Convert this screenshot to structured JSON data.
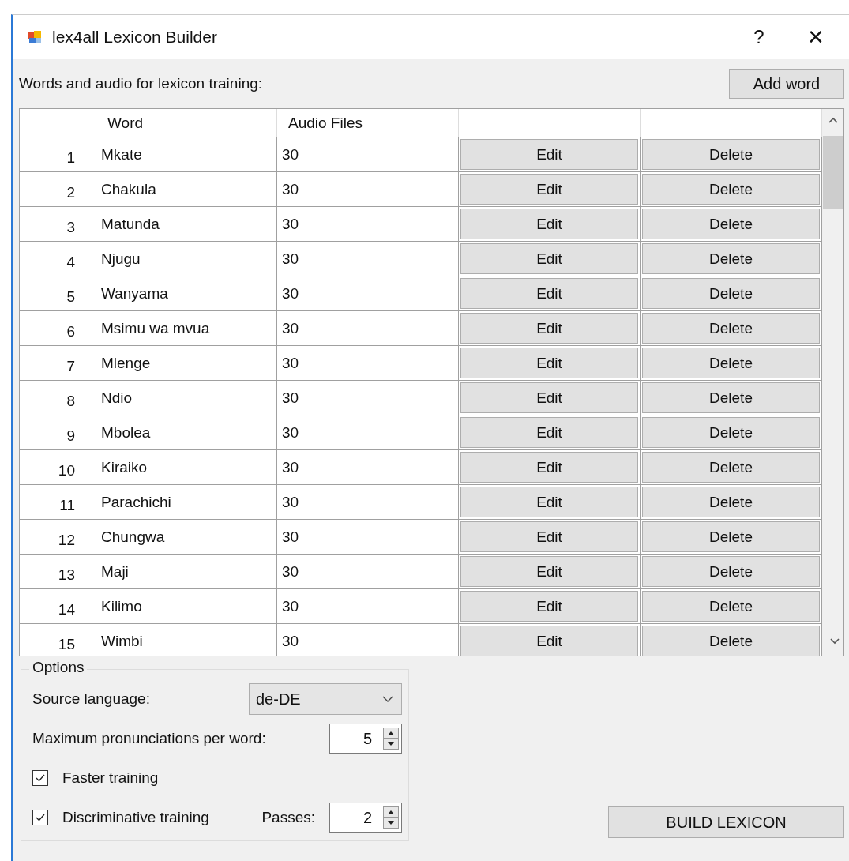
{
  "window": {
    "title": "lex4all Lexicon Builder",
    "help": "?",
    "close": "✕"
  },
  "list_label": "Words and audio for lexicon training:",
  "add_button": "Add word",
  "table": {
    "columns": [
      "Word",
      "Audio Files"
    ],
    "rows": [
      {
        "number": "1",
        "word": "Mkate",
        "audio_files": "30",
        "edit": "Edit",
        "delete": "Delete"
      },
      {
        "number": "2",
        "word": "Chakula",
        "audio_files": "30",
        "edit": "Edit",
        "delete": "Delete"
      },
      {
        "number": "3",
        "word": "Matunda",
        "audio_files": "30",
        "edit": "Edit",
        "delete": "Delete"
      },
      {
        "number": "4",
        "word": "Njugu",
        "audio_files": "30",
        "edit": "Edit",
        "delete": "Delete"
      },
      {
        "number": "5",
        "word": "Wanyama",
        "audio_files": "30",
        "edit": "Edit",
        "delete": "Delete"
      },
      {
        "number": "6",
        "word": "Msimu wa mvua",
        "audio_files": "30",
        "edit": "Edit",
        "delete": "Delete"
      },
      {
        "number": "7",
        "word": "Mlenge",
        "audio_files": "30",
        "edit": "Edit",
        "delete": "Delete"
      },
      {
        "number": "8",
        "word": "Ndio",
        "audio_files": "30",
        "edit": "Edit",
        "delete": "Delete"
      },
      {
        "number": "9",
        "word": "Mbolea",
        "audio_files": "30",
        "edit": "Edit",
        "delete": "Delete"
      },
      {
        "number": "10",
        "word": "Kiraiko",
        "audio_files": "30",
        "edit": "Edit",
        "delete": "Delete"
      },
      {
        "number": "11",
        "word": "Parachichi",
        "audio_files": "30",
        "edit": "Edit",
        "delete": "Delete"
      },
      {
        "number": "12",
        "word": "Chungwa",
        "audio_files": "30",
        "edit": "Edit",
        "delete": "Delete"
      },
      {
        "number": "13",
        "word": "Maji",
        "audio_files": "30",
        "edit": "Edit",
        "delete": "Delete"
      },
      {
        "number": "14",
        "word": "Kilimo",
        "audio_files": "30",
        "edit": "Edit",
        "delete": "Delete"
      },
      {
        "number": "15",
        "word": "Wimbi",
        "audio_files": "30",
        "edit": "Edit",
        "delete": "Delete"
      }
    ]
  },
  "options": {
    "title": "Options",
    "source_language": {
      "label": "Source language:",
      "value": "de-DE"
    },
    "max_pronunciations": {
      "label": "Maximum pronunciations per word:",
      "value": "5"
    },
    "faster_training": {
      "label": "Faster training",
      "checked": true
    },
    "discriminative_training": {
      "label": "Discriminative training",
      "checked": true
    },
    "passes": {
      "label": "Passes:",
      "value": "2"
    }
  },
  "build_button": "BUILD LEXICON"
}
